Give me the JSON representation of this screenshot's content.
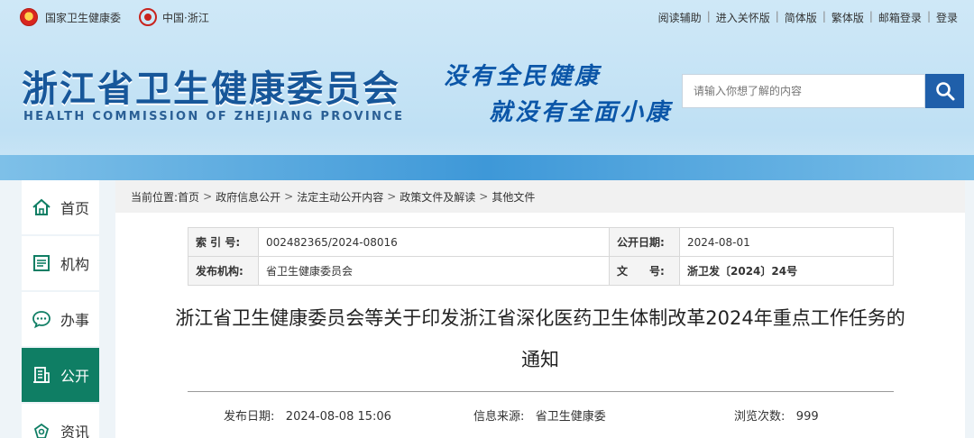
{
  "topbar": {
    "left": [
      {
        "icon": "national-emblem-icon",
        "label": "国家卫生健康委"
      },
      {
        "icon": "zhejiang-logo-icon",
        "label": "中国·浙江"
      }
    ],
    "right": [
      "阅读辅助",
      "进入关怀版",
      "简体版",
      "繁体版",
      "邮箱登录",
      "登录"
    ]
  },
  "header": {
    "title": "浙江省卫生健康委员会",
    "subtitle": "HEALTH COMMISSION OF ZHEJIANG PROVINCE",
    "slogan_line1": "没有全民健康",
    "slogan_line2": "就没有全面小康",
    "search_placeholder": "请输入你想了解的内容"
  },
  "sidebar": {
    "items": [
      {
        "label": "首页",
        "icon": "home-icon",
        "active": false
      },
      {
        "label": "机构",
        "icon": "org-icon",
        "active": false
      },
      {
        "label": "办事",
        "icon": "chat-icon",
        "active": false
      },
      {
        "label": "公开",
        "icon": "building-icon",
        "active": true
      },
      {
        "label": "资讯",
        "icon": "news-icon",
        "active": false
      }
    ]
  },
  "breadcrumb": {
    "prefix": "当前位置:",
    "items": [
      "首页",
      "政府信息公开",
      "法定主动公开内容",
      "政策文件及解读",
      "其他文件"
    ]
  },
  "meta": {
    "index_label": "索 引 号:",
    "index_value": "002482365/2024-08016",
    "pubdate_label": "公开日期:",
    "pubdate_value": "2024-08-01",
    "org_label": "发布机构:",
    "org_value": "省卫生健康委员会",
    "docno_label": "文　　号:",
    "docno_value": "浙卫发〔2024〕24号"
  },
  "article": {
    "title": "浙江省卫生健康委员会等关于印发浙江省深化医药卫生体制改革2024年重点工作任务的通知",
    "publish_label": "发布日期:",
    "publish_value": "2024-08-08 15:06",
    "source_label": "信息来源:",
    "source_value": "省卫生健康委",
    "views_label": "浏览次数:",
    "views_value": "999"
  },
  "colors": {
    "brand_blue": "#17579a",
    "active_green": "#0f7e64",
    "search_button": "#1f5faa"
  }
}
